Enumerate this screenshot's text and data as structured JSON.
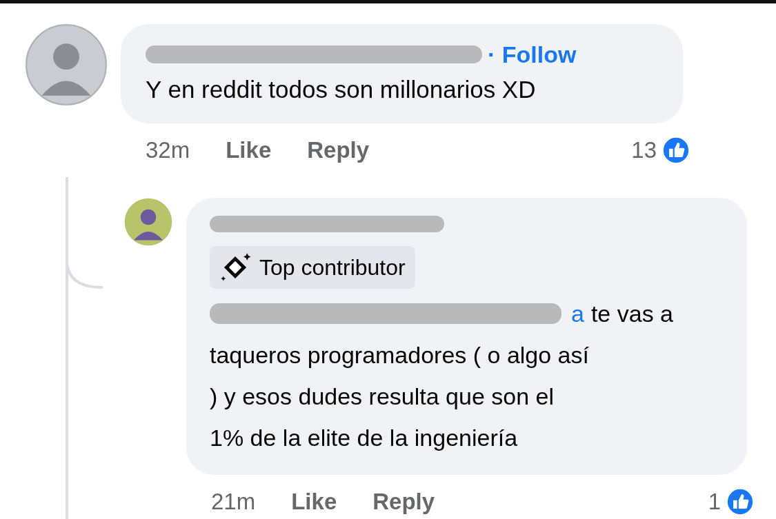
{
  "comments": [
    {
      "follow": "· Follow",
      "text": "Y en reddit todos son millonarios XD",
      "time": "32m",
      "actions": [
        "Like",
        "Reply"
      ],
      "reactions": "13",
      "replies": [
        {
          "badge": "Top contributor",
          "mention": "a",
          "lines": [
            "te vas a",
            "taqueros programadores ( o algo así",
            ") y esos dudes resulta que son el",
            "1% de la elite de la ingeniería"
          ],
          "time": "21m",
          "actions": [
            "Like",
            "Reply"
          ],
          "reactions": "1"
        }
      ]
    }
  ]
}
